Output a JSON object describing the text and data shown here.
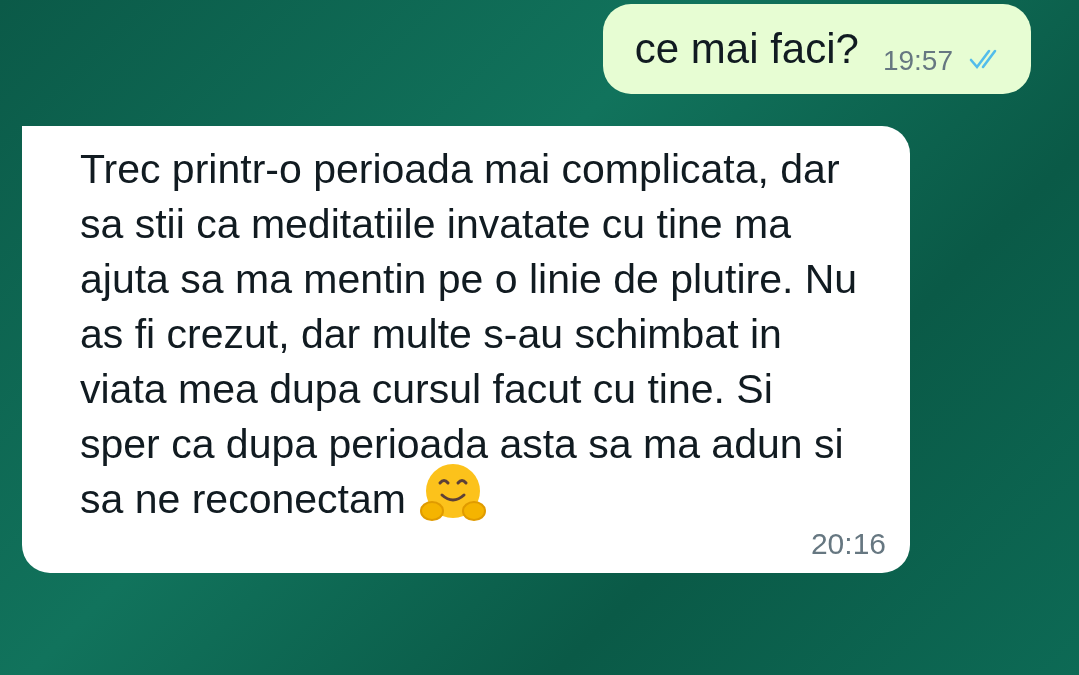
{
  "messages": [
    {
      "kind": "outgoing",
      "text": "ce mai faci?",
      "time": "19:57",
      "read": true
    },
    {
      "kind": "incoming",
      "text": "Trec printr-o perioada mai complicata, dar sa stii ca meditatiile invatate cu tine ma ajuta sa ma mentin pe o linie de plutire. Nu as fi crezut, dar multe s-au schimbat in viata mea dupa cursul facut cu tine. Si sper ca dupa perioada asta sa ma adun si sa ne reconectam",
      "time": "20:16",
      "emoji": true
    }
  ]
}
